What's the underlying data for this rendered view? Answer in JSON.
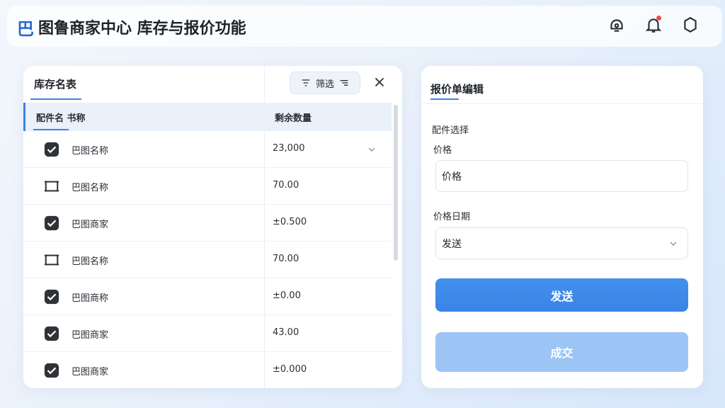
{
  "header": {
    "brand_mark": "巴",
    "title": "图鲁商家中心  库存与报价功能"
  },
  "icons": {
    "top": [
      "support-icon",
      "bell-icon",
      "hexagon-icon"
    ]
  },
  "inventory": {
    "title": "库存名表",
    "filter_label": "筛选",
    "columns": [
      "配件名 书称",
      "剩余数量"
    ],
    "rows": [
      {
        "checked": true,
        "name": "巴图名称",
        "qty": "23,000",
        "expandable": true
      },
      {
        "checked": false,
        "name": "巴图名称",
        "qty": "70.00"
      },
      {
        "checked": true,
        "name": "巴图商家",
        "qty": "±0.500"
      },
      {
        "checked": false,
        "name": "巴图名称",
        "qty": "70.00"
      },
      {
        "checked": true,
        "name": "巴图商称",
        "qty": "±0.00"
      },
      {
        "checked": true,
        "name": "巴图商家",
        "qty": "43.00"
      },
      {
        "checked": true,
        "name": "巴图商家",
        "qty": "±0.000"
      }
    ]
  },
  "quote": {
    "title": "报价单编辑",
    "section_label": "配件选择",
    "price_label": "价格",
    "price_value": "价格",
    "period_label": "价格日期",
    "period_value": "发送",
    "send_label": "发送",
    "deal_label": "成交"
  }
}
